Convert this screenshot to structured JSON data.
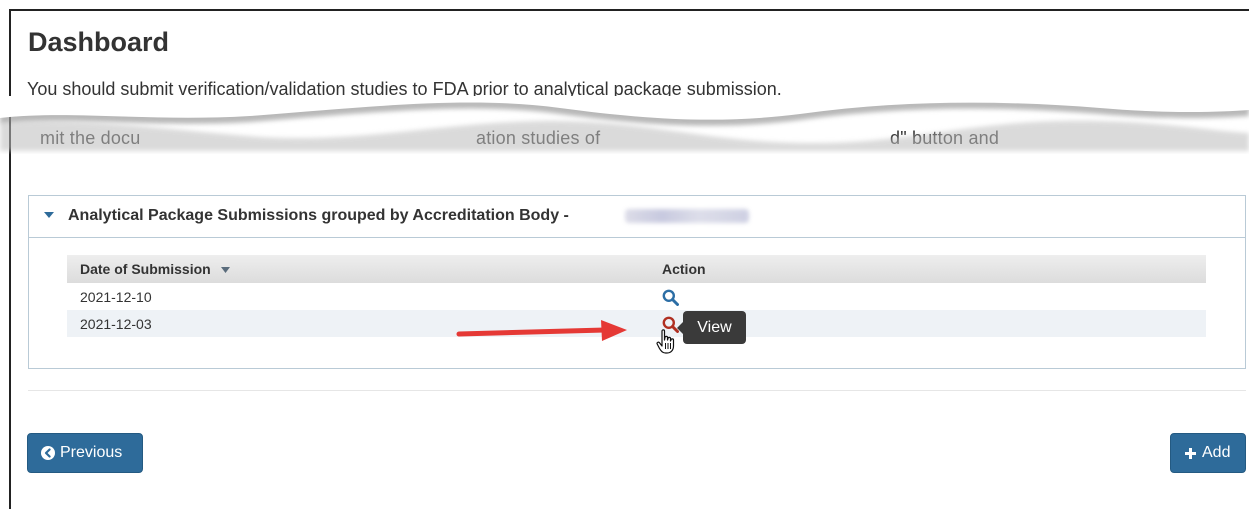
{
  "page": {
    "title": "Dashboard",
    "intro": "You should submit verification/validation studies to FDA prior to analytical package submission.",
    "cut_text": "...mit the docu...                          ...ation studies of...                                            ...d\" button and..."
  },
  "panel": {
    "title": "Analytical Package Submissions grouped by Accreditation Body -",
    "redacted_value": ""
  },
  "table": {
    "columns": [
      "Date of Submission",
      "Action"
    ],
    "rows": [
      {
        "date": "2021-12-10",
        "action_icon": "search-icon"
      },
      {
        "date": "2021-12-03",
        "action_icon": "search-icon"
      }
    ]
  },
  "tooltip": {
    "text": "View"
  },
  "buttons": {
    "previous": "Previous",
    "add": "Add"
  },
  "colors": {
    "primary": "#2e6b9a",
    "action_icon": "#2c6ea5",
    "action_icon_hover": "#b03022",
    "annotation_arrow": "#e53935",
    "tooltip_bg": "#3a3a3a"
  }
}
